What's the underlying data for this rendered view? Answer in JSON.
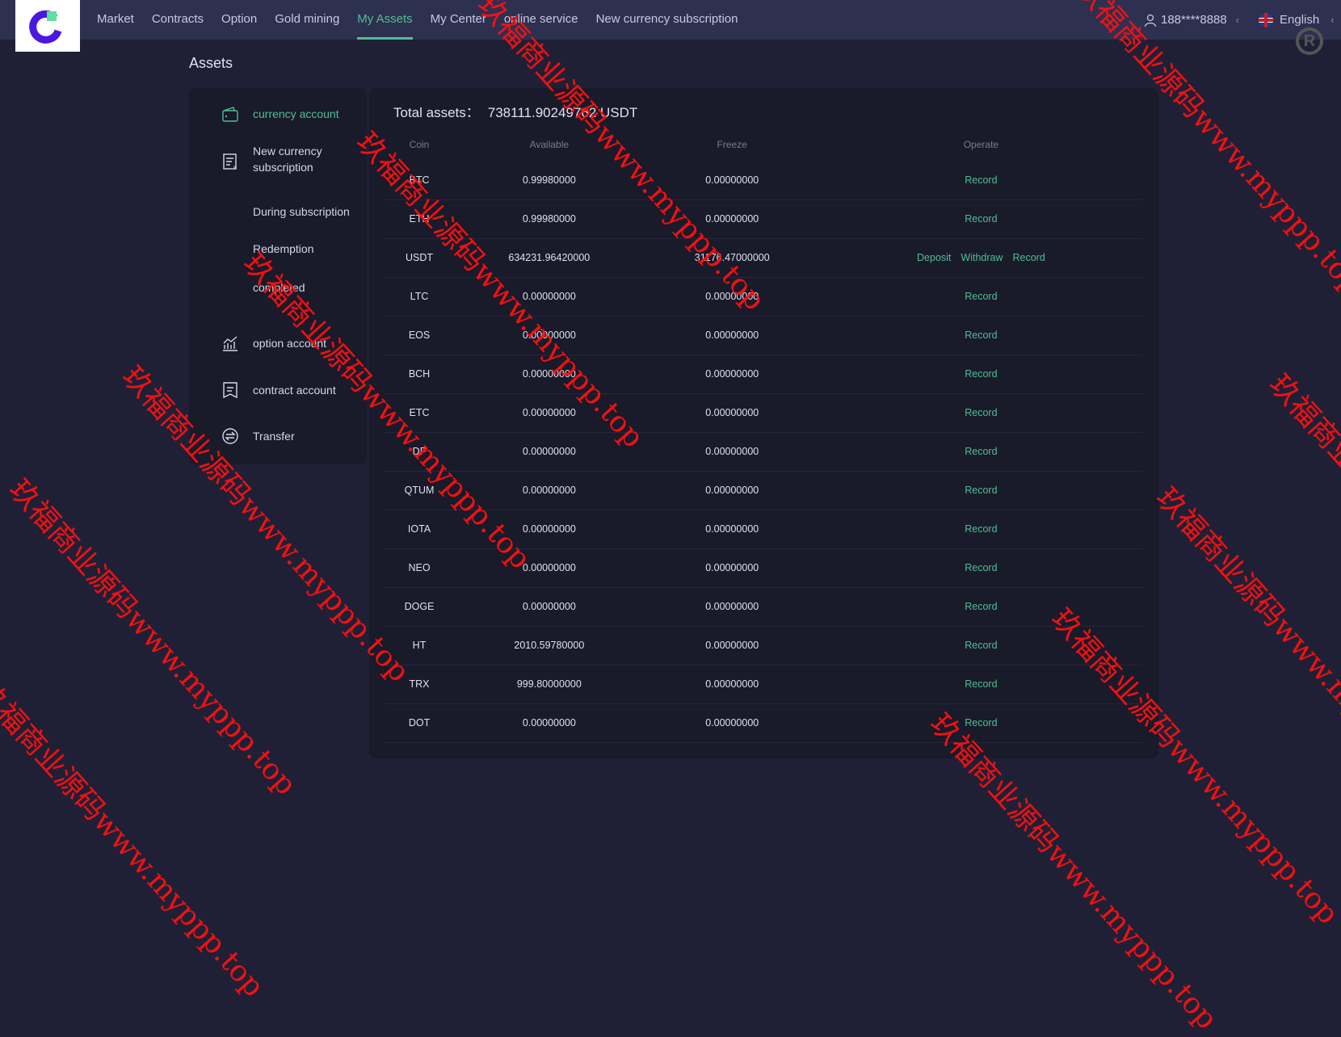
{
  "header": {
    "nav": [
      "Market",
      "Contracts",
      "Option",
      "Gold mining",
      "My Assets",
      "My Center",
      "online service",
      "New currency subscription"
    ],
    "active_index": 4,
    "user": "188****8888",
    "language": "English"
  },
  "page": {
    "title": "Assets"
  },
  "sidebar": {
    "items": [
      {
        "label": "currency account",
        "icon": "wallet-icon"
      },
      {
        "label": "New currency subscription",
        "icon": "document-yen-icon"
      },
      {
        "label": "During subscription"
      },
      {
        "label": "Redemption"
      },
      {
        "label": "completed"
      },
      {
        "label": "option account",
        "icon": "chart-line-icon"
      },
      {
        "label": "contract account",
        "icon": "bookmark-document-icon"
      },
      {
        "label": "Transfer",
        "icon": "transfer-icon"
      }
    ]
  },
  "main": {
    "total_label": "Total assets：",
    "total_value": "738111.90249762 USDT",
    "columns": [
      "Coin",
      "Available",
      "Freeze",
      "Operate"
    ],
    "actions": {
      "deposit": "Deposit",
      "withdraw": "Withdraw",
      "record": "Record"
    },
    "rows": [
      {
        "coin": "BTC",
        "available": "0.99980000",
        "freeze": "0.00000000"
      },
      {
        "coin": "ETH",
        "available": "0.99980000",
        "freeze": "0.00000000"
      },
      {
        "coin": "USDT",
        "available": "634231.96420000",
        "freeze": "31176.47000000",
        "full_ops": true
      },
      {
        "coin": "LTC",
        "available": "0.00000000",
        "freeze": "0.00000000"
      },
      {
        "coin": "EOS",
        "available": "0.00000000",
        "freeze": "0.00000000"
      },
      {
        "coin": "BCH",
        "available": "0.00000000",
        "freeze": "0.00000000"
      },
      {
        "coin": "ETC",
        "available": "0.00000000",
        "freeze": "0.00000000"
      },
      {
        "coin": "DF",
        "available": "0.00000000",
        "freeze": "0.00000000"
      },
      {
        "coin": "QTUM",
        "available": "0.00000000",
        "freeze": "0.00000000"
      },
      {
        "coin": "IOTA",
        "available": "0.00000000",
        "freeze": "0.00000000"
      },
      {
        "coin": "NEO",
        "available": "0.00000000",
        "freeze": "0.00000000"
      },
      {
        "coin": "DOGE",
        "available": "0.00000000",
        "freeze": "0.00000000"
      },
      {
        "coin": "HT",
        "available": "2010.59780000",
        "freeze": "0.00000000"
      },
      {
        "coin": "TRX",
        "available": "999.80000000",
        "freeze": "0.00000000"
      },
      {
        "coin": "DOT",
        "available": "0.00000000",
        "freeze": "0.00000000"
      }
    ]
  },
  "watermark": "玖福商业源码www.myppp.top",
  "colors": {
    "accent": "#4fbf94",
    "header": "#2e3050",
    "background": "#1f2036",
    "card": "#191a2a"
  }
}
